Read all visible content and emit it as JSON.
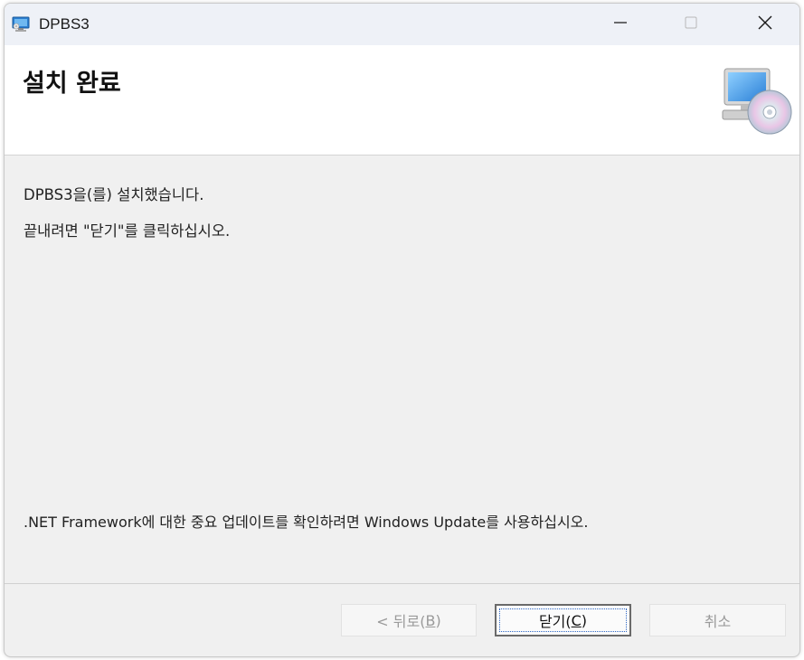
{
  "window": {
    "title": "DPBS3",
    "app_icon": "installer-monitor-icon"
  },
  "titlebar_controls": {
    "minimize_icon": "minimize-icon",
    "maximize_icon": "maximize-icon",
    "close_icon": "close-icon"
  },
  "header": {
    "title": "설치 완료",
    "icon": "computer-cd-icon"
  },
  "body": {
    "line1": "DPBS3을(를) 설치했습니다.",
    "line2": "끝내려면 \"닫기\"를 클릭하십시오.",
    "note": ".NET Framework에 대한 중요 업데이트를 확인하려면 Windows Update를 사용하십시오."
  },
  "buttons": {
    "back": {
      "prefix": "< 뒤로(",
      "mnemonic": "B",
      "suffix": ")",
      "enabled": false
    },
    "close": {
      "prefix": "닫기(",
      "mnemonic": "C",
      "suffix": ")",
      "enabled": true,
      "default": true
    },
    "cancel": {
      "label": "취소",
      "enabled": false
    }
  },
  "colors": {
    "titlebar_bg": "#eef1f7",
    "content_bg": "#f0f0f0",
    "header_bg": "#ffffff",
    "disabled_text": "#9a9a9a",
    "focus_rect": "#2f68c6"
  }
}
